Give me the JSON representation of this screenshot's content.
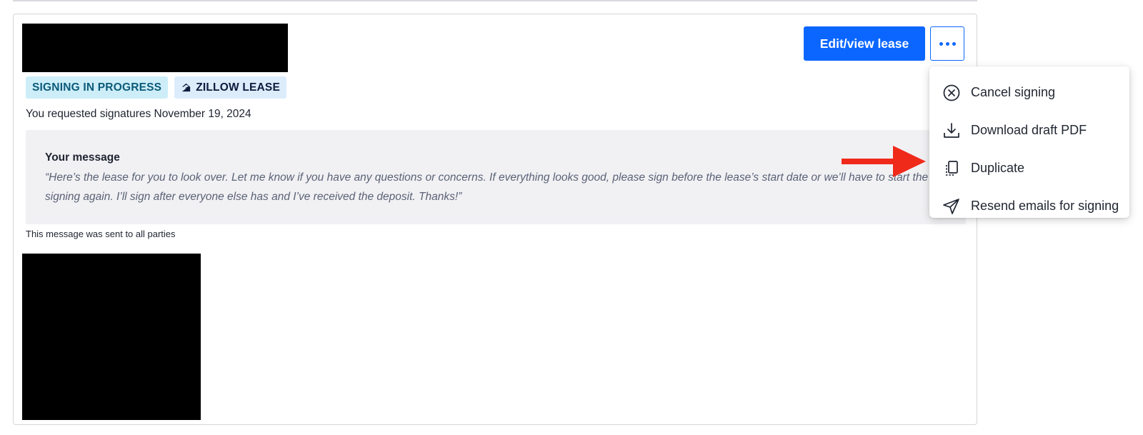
{
  "badges": {
    "status": "SIGNING IN PROGRESS",
    "lease_type": "ZILLOW LEASE"
  },
  "requested_text": "You requested signatures November 19, 2024",
  "message": {
    "title": "Your message",
    "body": "“Here’s the lease for you to look over. Let me know if you have any questions or concerns. If everything looks good, please sign before the lease’s start date or we’ll have to start the signing again. I’ll sign after everyone else has and I’ve received the deposit. Thanks!”"
  },
  "sent_note": "This message was sent to all parties",
  "actions": {
    "edit_label": "Edit/view lease"
  },
  "menu": {
    "items": [
      {
        "label": "Cancel signing",
        "icon": "cancel-circle-icon"
      },
      {
        "label": "Download draft PDF",
        "icon": "download-icon"
      },
      {
        "label": "Duplicate",
        "icon": "duplicate-icon"
      },
      {
        "label": "Resend emails for signing",
        "icon": "send-icon"
      }
    ]
  },
  "colors": {
    "primary": "#0a66ff",
    "annotation_arrow": "#f02a1b",
    "status_badge_bg": "#cdeef8",
    "lease_badge_bg": "#dcecfb"
  }
}
